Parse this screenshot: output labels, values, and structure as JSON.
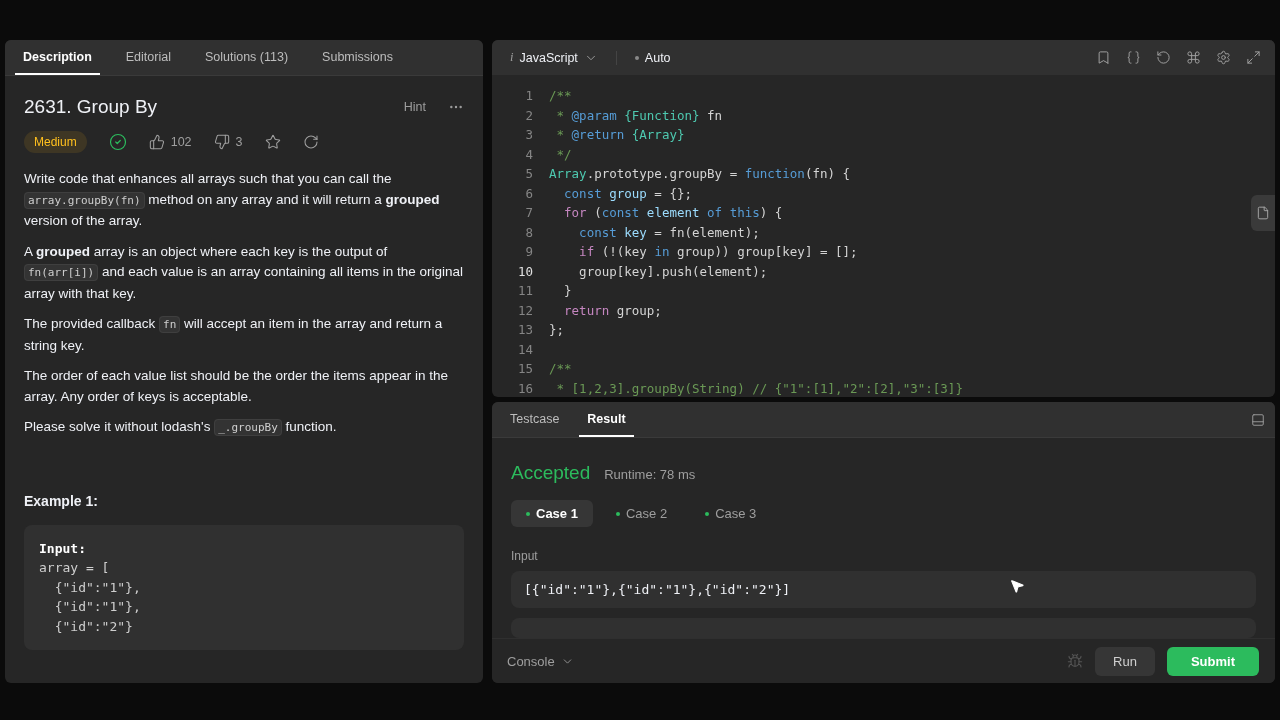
{
  "description_panel": {
    "tabs": [
      {
        "label": "Description",
        "selected": true
      },
      {
        "label": "Editorial",
        "selected": false
      },
      {
        "label": "Solutions (113)",
        "selected": false
      },
      {
        "label": "Submissions",
        "selected": false
      }
    ],
    "title": "2631. Group By",
    "hint": "Hint",
    "difficulty": "Medium",
    "solved": true,
    "likes": "102",
    "dislikes": "3",
    "paragraphs": [
      [
        {
          "kind": "text",
          "text": "Write code that enhances all arrays such that you can call the "
        },
        {
          "kind": "code",
          "text": "array.groupBy(fn)"
        },
        {
          "kind": "text",
          "text": " method on any array and it will return a **grouped** version of the array."
        }
      ],
      [
        {
          "kind": "text",
          "text": "A **grouped** array is an object where each key is the output of "
        },
        {
          "kind": "code",
          "text": "fn(arr[i])"
        },
        {
          "kind": "text",
          "text": " and each value is an array containing all items in the original array with that key."
        }
      ],
      [
        {
          "kind": "text",
          "text": "The provided callback "
        },
        {
          "kind": "code",
          "text": "fn"
        },
        {
          "kind": "text",
          "text": " will accept an item in the array and return a string key."
        }
      ],
      [
        {
          "kind": "text",
          "text": "The order of each value list should be the order the items appear in the array. Any order of keys is acceptable."
        }
      ],
      [
        {
          "kind": "text",
          "text": "Please solve it without lodash's "
        },
        {
          "kind": "code",
          "text": "_.groupBy"
        },
        {
          "kind": "text",
          "text": " function."
        }
      ]
    ],
    "example_title": "Example 1:",
    "example_lines": [
      {
        "kind": "label",
        "text": "Input:"
      },
      {
        "kind": "code",
        "text": "array = ["
      },
      {
        "kind": "code",
        "text": "  {\"id\":\"1\"},"
      },
      {
        "kind": "code",
        "text": "  {\"id\":\"1\"},"
      },
      {
        "kind": "code",
        "text": "  {\"id\":\"2\"}"
      }
    ]
  },
  "editor": {
    "language_glyph": "i",
    "language": "JavaScript",
    "mode": "Auto",
    "lines": [
      {
        "number": "1",
        "current": false,
        "tokens": [
          {
            "kind": "comment",
            "text": "/**"
          }
        ]
      },
      {
        "number": "2",
        "current": false,
        "tokens": [
          {
            "kind": "comment",
            "text": " * "
          },
          {
            "kind": "tag",
            "text": "@param "
          },
          {
            "kind": "type",
            "text": "{Function}"
          },
          {
            "kind": "plain",
            "text": " fn"
          }
        ]
      },
      {
        "number": "3",
        "current": false,
        "tokens": [
          {
            "kind": "comment",
            "text": " * "
          },
          {
            "kind": "tag",
            "text": "@return "
          },
          {
            "kind": "type",
            "text": "{Array}"
          }
        ]
      },
      {
        "number": "4",
        "current": false,
        "tokens": [
          {
            "kind": "comment",
            "text": " */"
          }
        ]
      },
      {
        "number": "5",
        "current": false,
        "tokens": [
          {
            "kind": "type",
            "text": "Array"
          },
          {
            "kind": "plain",
            "text": ".prototype.groupBy = "
          },
          {
            "kind": "keyword",
            "text": "function"
          },
          {
            "kind": "plain",
            "text": "(fn) {"
          }
        ]
      },
      {
        "number": "6",
        "current": false,
        "tokens": [
          {
            "kind": "keyword",
            "text": "  const"
          },
          {
            "kind": "var",
            "text": " group"
          },
          {
            "kind": "plain",
            "text": " = {};"
          }
        ]
      },
      {
        "number": "7",
        "current": false,
        "tokens": [
          {
            "kind": "control",
            "text": "  for"
          },
          {
            "kind": "plain",
            "text": " ("
          },
          {
            "kind": "keyword",
            "text": "const"
          },
          {
            "kind": "var",
            "text": " element"
          },
          {
            "kind": "keyword",
            "text": " of"
          },
          {
            "kind": "keyword",
            "text": " this"
          },
          {
            "kind": "plain",
            "text": ") {"
          }
        ]
      },
      {
        "number": "8",
        "current": false,
        "tokens": [
          {
            "kind": "keyword",
            "text": "    const"
          },
          {
            "kind": "var",
            "text": " key"
          },
          {
            "kind": "plain",
            "text": " = fn(element);"
          }
        ]
      },
      {
        "number": "9",
        "current": false,
        "tokens": [
          {
            "kind": "control",
            "text": "    if"
          },
          {
            "kind": "plain",
            "text": " (!(key "
          },
          {
            "kind": "keyword",
            "text": "in"
          },
          {
            "kind": "plain",
            "text": " group)) group[key] = [];"
          }
        ]
      },
      {
        "number": "10",
        "current": true,
        "tokens": [
          {
            "kind": "plain",
            "text": "    group[key].push(element);"
          }
        ]
      },
      {
        "number": "11",
        "current": false,
        "tokens": [
          {
            "kind": "plain",
            "text": "  }"
          }
        ]
      },
      {
        "number": "12",
        "current": false,
        "tokens": [
          {
            "kind": "control",
            "text": "  return"
          },
          {
            "kind": "plain",
            "text": " group;"
          }
        ]
      },
      {
        "number": "13",
        "current": false,
        "tokens": [
          {
            "kind": "plain",
            "text": "};"
          }
        ]
      },
      {
        "number": "14",
        "current": false
      },
      {
        "number": "15",
        "current": false,
        "tokens": [
          {
            "kind": "comment",
            "text": "/**"
          }
        ]
      },
      {
        "number": "16",
        "current": false,
        "tokens": [
          {
            "kind": "comment",
            "text": " * [1,2,3].groupBy(String) // {\"1\":[1],\"2\":[2],\"3\":[3]}"
          }
        ]
      }
    ]
  },
  "results": {
    "tabs": [
      {
        "label": "Testcase",
        "selected": false
      },
      {
        "label": "Result",
        "selected": true
      }
    ],
    "verdict": "Accepted",
    "runtime": "Runtime: 78 ms",
    "cases": [
      {
        "label": "Case 1",
        "selected": true,
        "color": "#2cbb5d"
      },
      {
        "label": "Case 2",
        "selected": false,
        "color": "#2cbb5d"
      },
      {
        "label": "Case 3",
        "selected": false,
        "color": "#2cbb5d"
      }
    ],
    "input_label": "Input",
    "input_value": "[{\"id\":\"1\"},{\"id\":\"1\"},{\"id\":\"2\"}]",
    "console": "Console",
    "run": "Run",
    "submit": "Submit"
  }
}
